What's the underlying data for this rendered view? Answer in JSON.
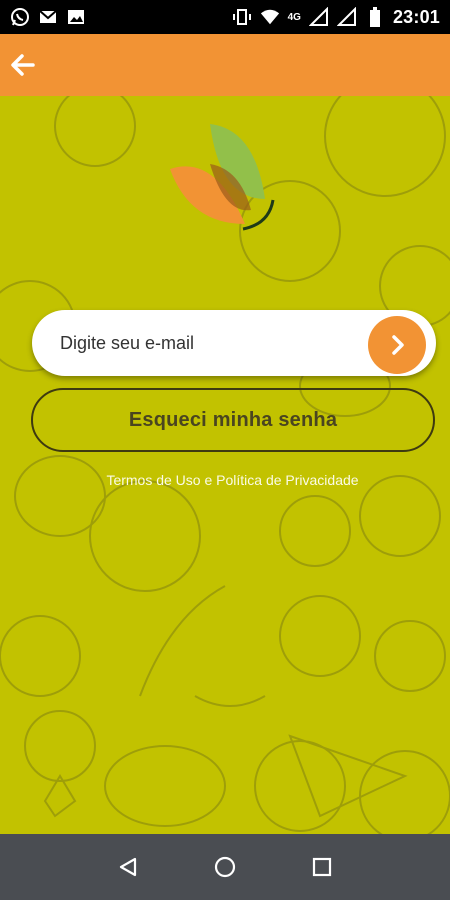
{
  "status_bar": {
    "time": "23:01",
    "network": "4G",
    "left_icons": [
      "whatsapp-icon",
      "gmail-icon",
      "image-icon"
    ],
    "right_icons": [
      "vibrate-icon",
      "wifi-icon",
      "signal-icon",
      "signal-icon",
      "battery-icon"
    ]
  },
  "app_bar": {
    "back_icon": "arrow-left-icon",
    "color": "#f29334"
  },
  "main": {
    "background_color": "#c2c200",
    "email": {
      "placeholder": "Digite seu e-mail",
      "value": ""
    },
    "submit_icon": "chevron-right-icon",
    "forgot_password_label": "Esqueci minha senha",
    "terms_link": "Termos de Uso e Política de Privacidade"
  },
  "nav_bar": {
    "back_icon": "triangle-back-icon",
    "home_icon": "circle-home-icon",
    "recents_icon": "square-recents-icon"
  }
}
